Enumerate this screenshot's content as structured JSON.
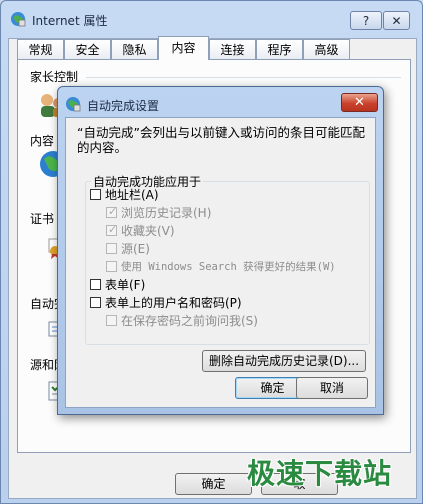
{
  "outer_window": {
    "title": "Internet 属性",
    "help_label": "?",
    "close_label": "✕",
    "tabs": [
      {
        "label": "常规"
      },
      {
        "label": "安全"
      },
      {
        "label": "隐私"
      },
      {
        "label": "内容",
        "active": true
      },
      {
        "label": "连接"
      },
      {
        "label": "程序"
      },
      {
        "label": "高级"
      }
    ],
    "sections": {
      "parental": "家长控制",
      "content_advisor": "内容",
      "certificates": "证书",
      "autocomplete": "自动完",
      "feeds": "源和网"
    },
    "ok_label": "确定",
    "cancel_label": "取"
  },
  "dialog": {
    "title": "自动完成设置",
    "close_label": "✕",
    "description": "“自动完成”会列出与以前键入或访问的条目可能匹配的内容。",
    "group_title": "自动完成功能应用于",
    "options": [
      {
        "label": "地址栏(A)",
        "checked": false,
        "enabled": true
      },
      {
        "label": "浏览历史记录(H)",
        "checked": true,
        "enabled": false
      },
      {
        "label": "收藏夹(V)",
        "checked": true,
        "enabled": false
      },
      {
        "label": "源(E)",
        "checked": false,
        "enabled": false
      },
      {
        "label": "使用 Windows Search 获得更好的结果(W)",
        "checked": false,
        "enabled": false
      },
      {
        "label": "表单(F)",
        "checked": false,
        "enabled": true
      },
      {
        "label": "表单上的用户名和密码(P)",
        "checked": false,
        "enabled": true
      },
      {
        "label": "在保存密码之前询问我(S)",
        "checked": false,
        "enabled": false
      }
    ],
    "delete_history_label": "删除自动完成历史记录(D)...",
    "ok_label": "确定",
    "cancel_label": "取消"
  },
  "watermark": "极速下载站",
  "colors": {
    "title_bar": "#bcd3f1",
    "close_red": "#c9432c",
    "watermark_green": "#2a8a3f"
  }
}
